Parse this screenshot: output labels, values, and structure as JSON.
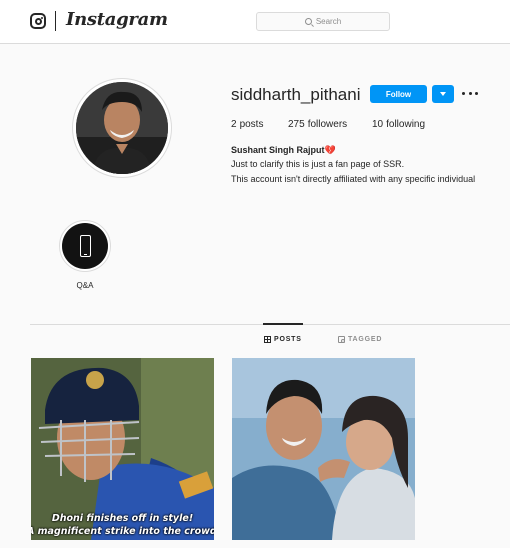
{
  "nav": {
    "brand": "Instagram",
    "search_placeholder": "Search"
  },
  "profile": {
    "username": "siddharth_pithani",
    "follow_label": "Follow",
    "stats": {
      "posts_count": "2",
      "posts_label": "posts",
      "followers_count": "275",
      "followers_label": "followers",
      "following_count": "10",
      "following_label": "following"
    },
    "full_name": "Sushant Singh Rajput💔",
    "bio_lines": [
      "Just to clarify this is just a fan page of SSR.",
      "This account isn't directly affiliated with any specific individual"
    ]
  },
  "highlights": [
    {
      "label": "Q&A",
      "icon": "phone-icon"
    }
  ],
  "tabs": [
    {
      "label": "POSTS",
      "icon": "grid-icon",
      "active": true
    },
    {
      "label": "TAGGED",
      "icon": "tag-icon",
      "active": false
    }
  ],
  "posts": [
    {
      "caption_lines": [
        "Dhoni finishes off in style!",
        "A magnificent strike into the crowd"
      ]
    },
    {
      "caption_lines": []
    }
  ],
  "colors": {
    "accent": "#0095f6",
    "text": "#262626",
    "muted": "#8e8e8e",
    "border": "#dbdbdb",
    "background": "#fafafa",
    "heart": "#c0392b"
  }
}
